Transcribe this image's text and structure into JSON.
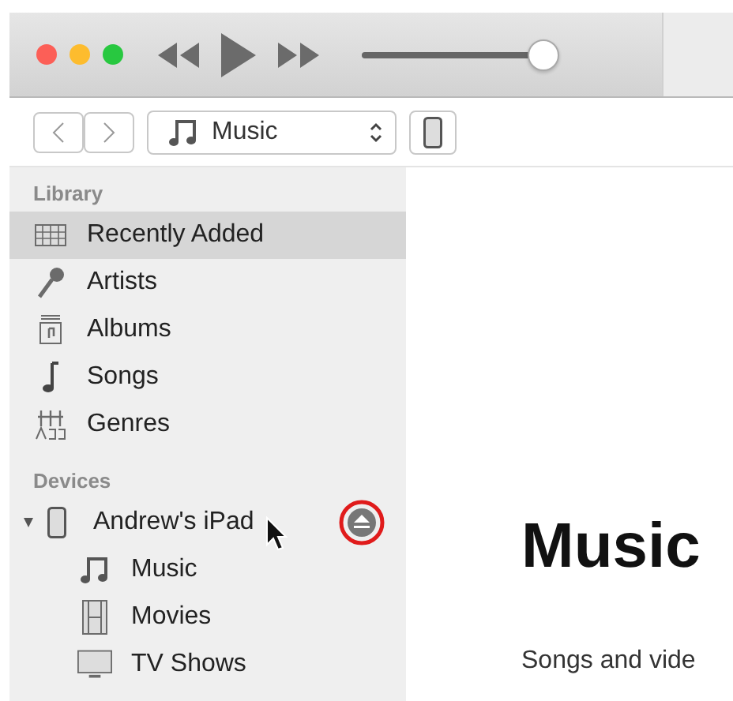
{
  "toolbar": {
    "volume": {
      "level": 0.97
    }
  },
  "navbar": {
    "source": "Music"
  },
  "sidebar": {
    "sections": [
      {
        "title": "Library",
        "items": [
          {
            "label": "Recently Added",
            "selected": true
          },
          {
            "label": "Artists",
            "selected": false
          },
          {
            "label": "Albums",
            "selected": false
          },
          {
            "label": "Songs",
            "selected": false
          },
          {
            "label": "Genres",
            "selected": false
          }
        ]
      },
      {
        "title": "Devices",
        "device": {
          "label": "Andrew's iPad",
          "expanded": true,
          "eject_circled": true,
          "children": [
            {
              "label": "Music",
              "selected": false
            },
            {
              "label": "Movies",
              "selected": false
            },
            {
              "label": "TV Shows",
              "selected": false
            }
          ]
        }
      }
    ]
  },
  "main": {
    "heading": "Music",
    "text": "Songs and vide"
  }
}
